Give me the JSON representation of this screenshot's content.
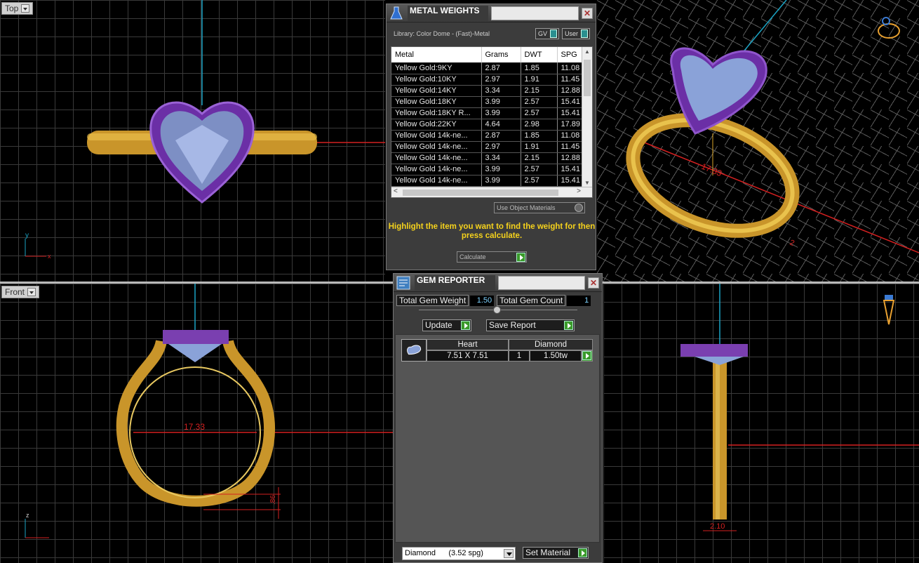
{
  "viewports": {
    "top": {
      "label": "Top"
    },
    "front": {
      "label": "Front"
    }
  },
  "dimensions": {
    "finger_size": "17.33",
    "shank_top": "2",
    "shank_bottom": ".86",
    "side_width": "2.10"
  },
  "metal_weights": {
    "title": "METAL WEIGHTS",
    "library": "Library: Color Dome - (Fast)-Metal",
    "gv_label": "GV",
    "user_label": "User",
    "columns": [
      "Metal",
      "Grams",
      "DWT",
      "SPG"
    ],
    "rows": [
      [
        "Yellow Gold:9KY",
        "2.87",
        "1.85",
        "11.08"
      ],
      [
        "Yellow Gold:10KY",
        "2.97",
        "1.91",
        "11.45"
      ],
      [
        "Yellow Gold:14KY",
        "3.34",
        "2.15",
        "12.88"
      ],
      [
        "Yellow Gold:18KY",
        "3.99",
        "2.57",
        "15.41"
      ],
      [
        "Yellow Gold:18KY R...",
        "3.99",
        "2.57",
        "15.41"
      ],
      [
        "Yellow Gold:22KY",
        "4.64",
        "2.98",
        "17.89"
      ],
      [
        "Yellow Gold 14k-ne...",
        "2.87",
        "1.85",
        "11.08"
      ],
      [
        "Yellow Gold 14k-ne...",
        "2.97",
        "1.91",
        "11.45"
      ],
      [
        "Yellow Gold 14k-ne...",
        "3.34",
        "2.15",
        "12.88"
      ],
      [
        "Yellow Gold 14k-ne...",
        "3.99",
        "2.57",
        "15.41"
      ],
      [
        "Yellow Gold 14k-ne...",
        "3.99",
        "2.57",
        "15.41"
      ]
    ],
    "use_object_materials": "Use Object Materials",
    "hint": "Highlight the item you want to find the weight for then press calculate.",
    "calculate": "Calculate"
  },
  "gem_reporter": {
    "title": "GEM REPORTER",
    "total_weight_label": "Total Gem Weight",
    "total_weight": "1.50",
    "total_count_label": "Total Gem Count",
    "total_count": "1",
    "update": "Update",
    "save_report": "Save Report",
    "gem": {
      "shape": "Heart",
      "material": "Diamond",
      "size": "7.51 X 7.51",
      "qty": "1",
      "weight": "1.50tw"
    },
    "material_select": "Diamond      (3.52 spg)",
    "set_material": "Set Material"
  },
  "colors": {
    "gold": "#d9a528",
    "bezel": "#7a3fb0",
    "stone": "#8aa2d8",
    "dimension": "#ff2020",
    "accent_teal": "#2a8f8f"
  }
}
